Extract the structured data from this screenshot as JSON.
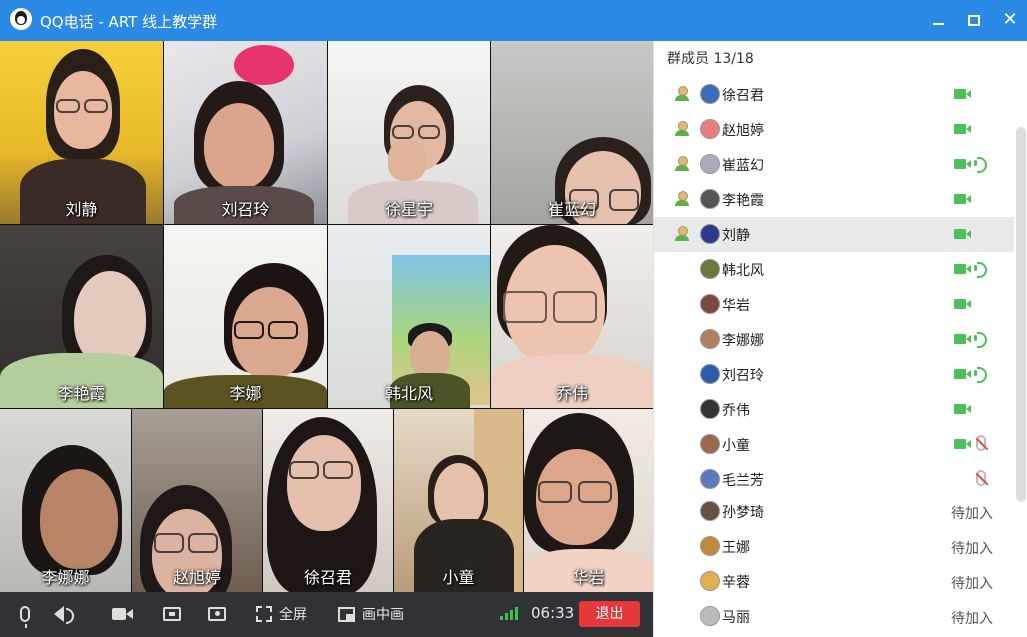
{
  "window": {
    "title": "QQ电话 - ART 线上教学群",
    "min_label": "—",
    "max_label": "□",
    "close_label": "✕"
  },
  "video_tiles": [
    {
      "name": "刘静"
    },
    {
      "name": "刘召玲"
    },
    {
      "name": "徐星宇"
    },
    {
      "name": "崔蓝幻"
    },
    {
      "name": "李艳霞"
    },
    {
      "name": "李娜"
    },
    {
      "name": "韩北风"
    },
    {
      "name": "乔伟"
    },
    {
      "name": "李娜娜"
    },
    {
      "name": "赵旭婷"
    },
    {
      "name": "徐召君"
    },
    {
      "name": "小童"
    },
    {
      "name": "华岩"
    }
  ],
  "toolbar": {
    "mic_icon": "microphone-icon",
    "speaker_icon": "speaker-icon",
    "camera_icon": "camera-icon",
    "share_icon": "screen-share-icon",
    "present_icon": "present-icon",
    "fullscreen_label": "全屏",
    "pip_label": "画中画",
    "timer": "06:33",
    "exit_label": "退出"
  },
  "members_panel": {
    "header": "群成员 13/18",
    "members": [
      {
        "name": "徐召君",
        "camera": true,
        "speaking": false,
        "muted": false,
        "status": ""
      },
      {
        "name": "赵旭婷",
        "camera": true,
        "speaking": false,
        "muted": false,
        "status": ""
      },
      {
        "name": "崔蓝幻",
        "camera": true,
        "speaking": true,
        "muted": false,
        "status": ""
      },
      {
        "name": "李艳霞",
        "camera": true,
        "speaking": false,
        "muted": false,
        "status": ""
      },
      {
        "name": "刘静",
        "camera": true,
        "speaking": false,
        "muted": false,
        "status": "",
        "selected": true
      },
      {
        "name": "韩北风",
        "camera": true,
        "speaking": true,
        "muted": false,
        "status": ""
      },
      {
        "name": "华岩",
        "camera": true,
        "speaking": false,
        "muted": false,
        "status": ""
      },
      {
        "name": "李娜娜",
        "camera": true,
        "speaking": true,
        "muted": false,
        "status": ""
      },
      {
        "name": "刘召玲",
        "camera": true,
        "speaking": true,
        "muted": false,
        "status": ""
      },
      {
        "name": "乔伟",
        "camera": true,
        "speaking": false,
        "muted": false,
        "status": ""
      },
      {
        "name": "小童",
        "camera": true,
        "speaking": false,
        "muted": true,
        "status": ""
      },
      {
        "name": "毛兰芳",
        "camera": false,
        "speaking": false,
        "muted": true,
        "status": ""
      },
      {
        "name": "孙梦琦",
        "camera": false,
        "speaking": false,
        "muted": false,
        "status": "待加入"
      },
      {
        "name": "王娜",
        "camera": false,
        "speaking": false,
        "muted": false,
        "status": "待加入"
      },
      {
        "name": "辛蓉",
        "camera": false,
        "speaking": false,
        "muted": false,
        "status": "待加入"
      },
      {
        "name": "马丽",
        "camera": false,
        "speaking": false,
        "muted": false,
        "status": "待加入"
      }
    ]
  }
}
